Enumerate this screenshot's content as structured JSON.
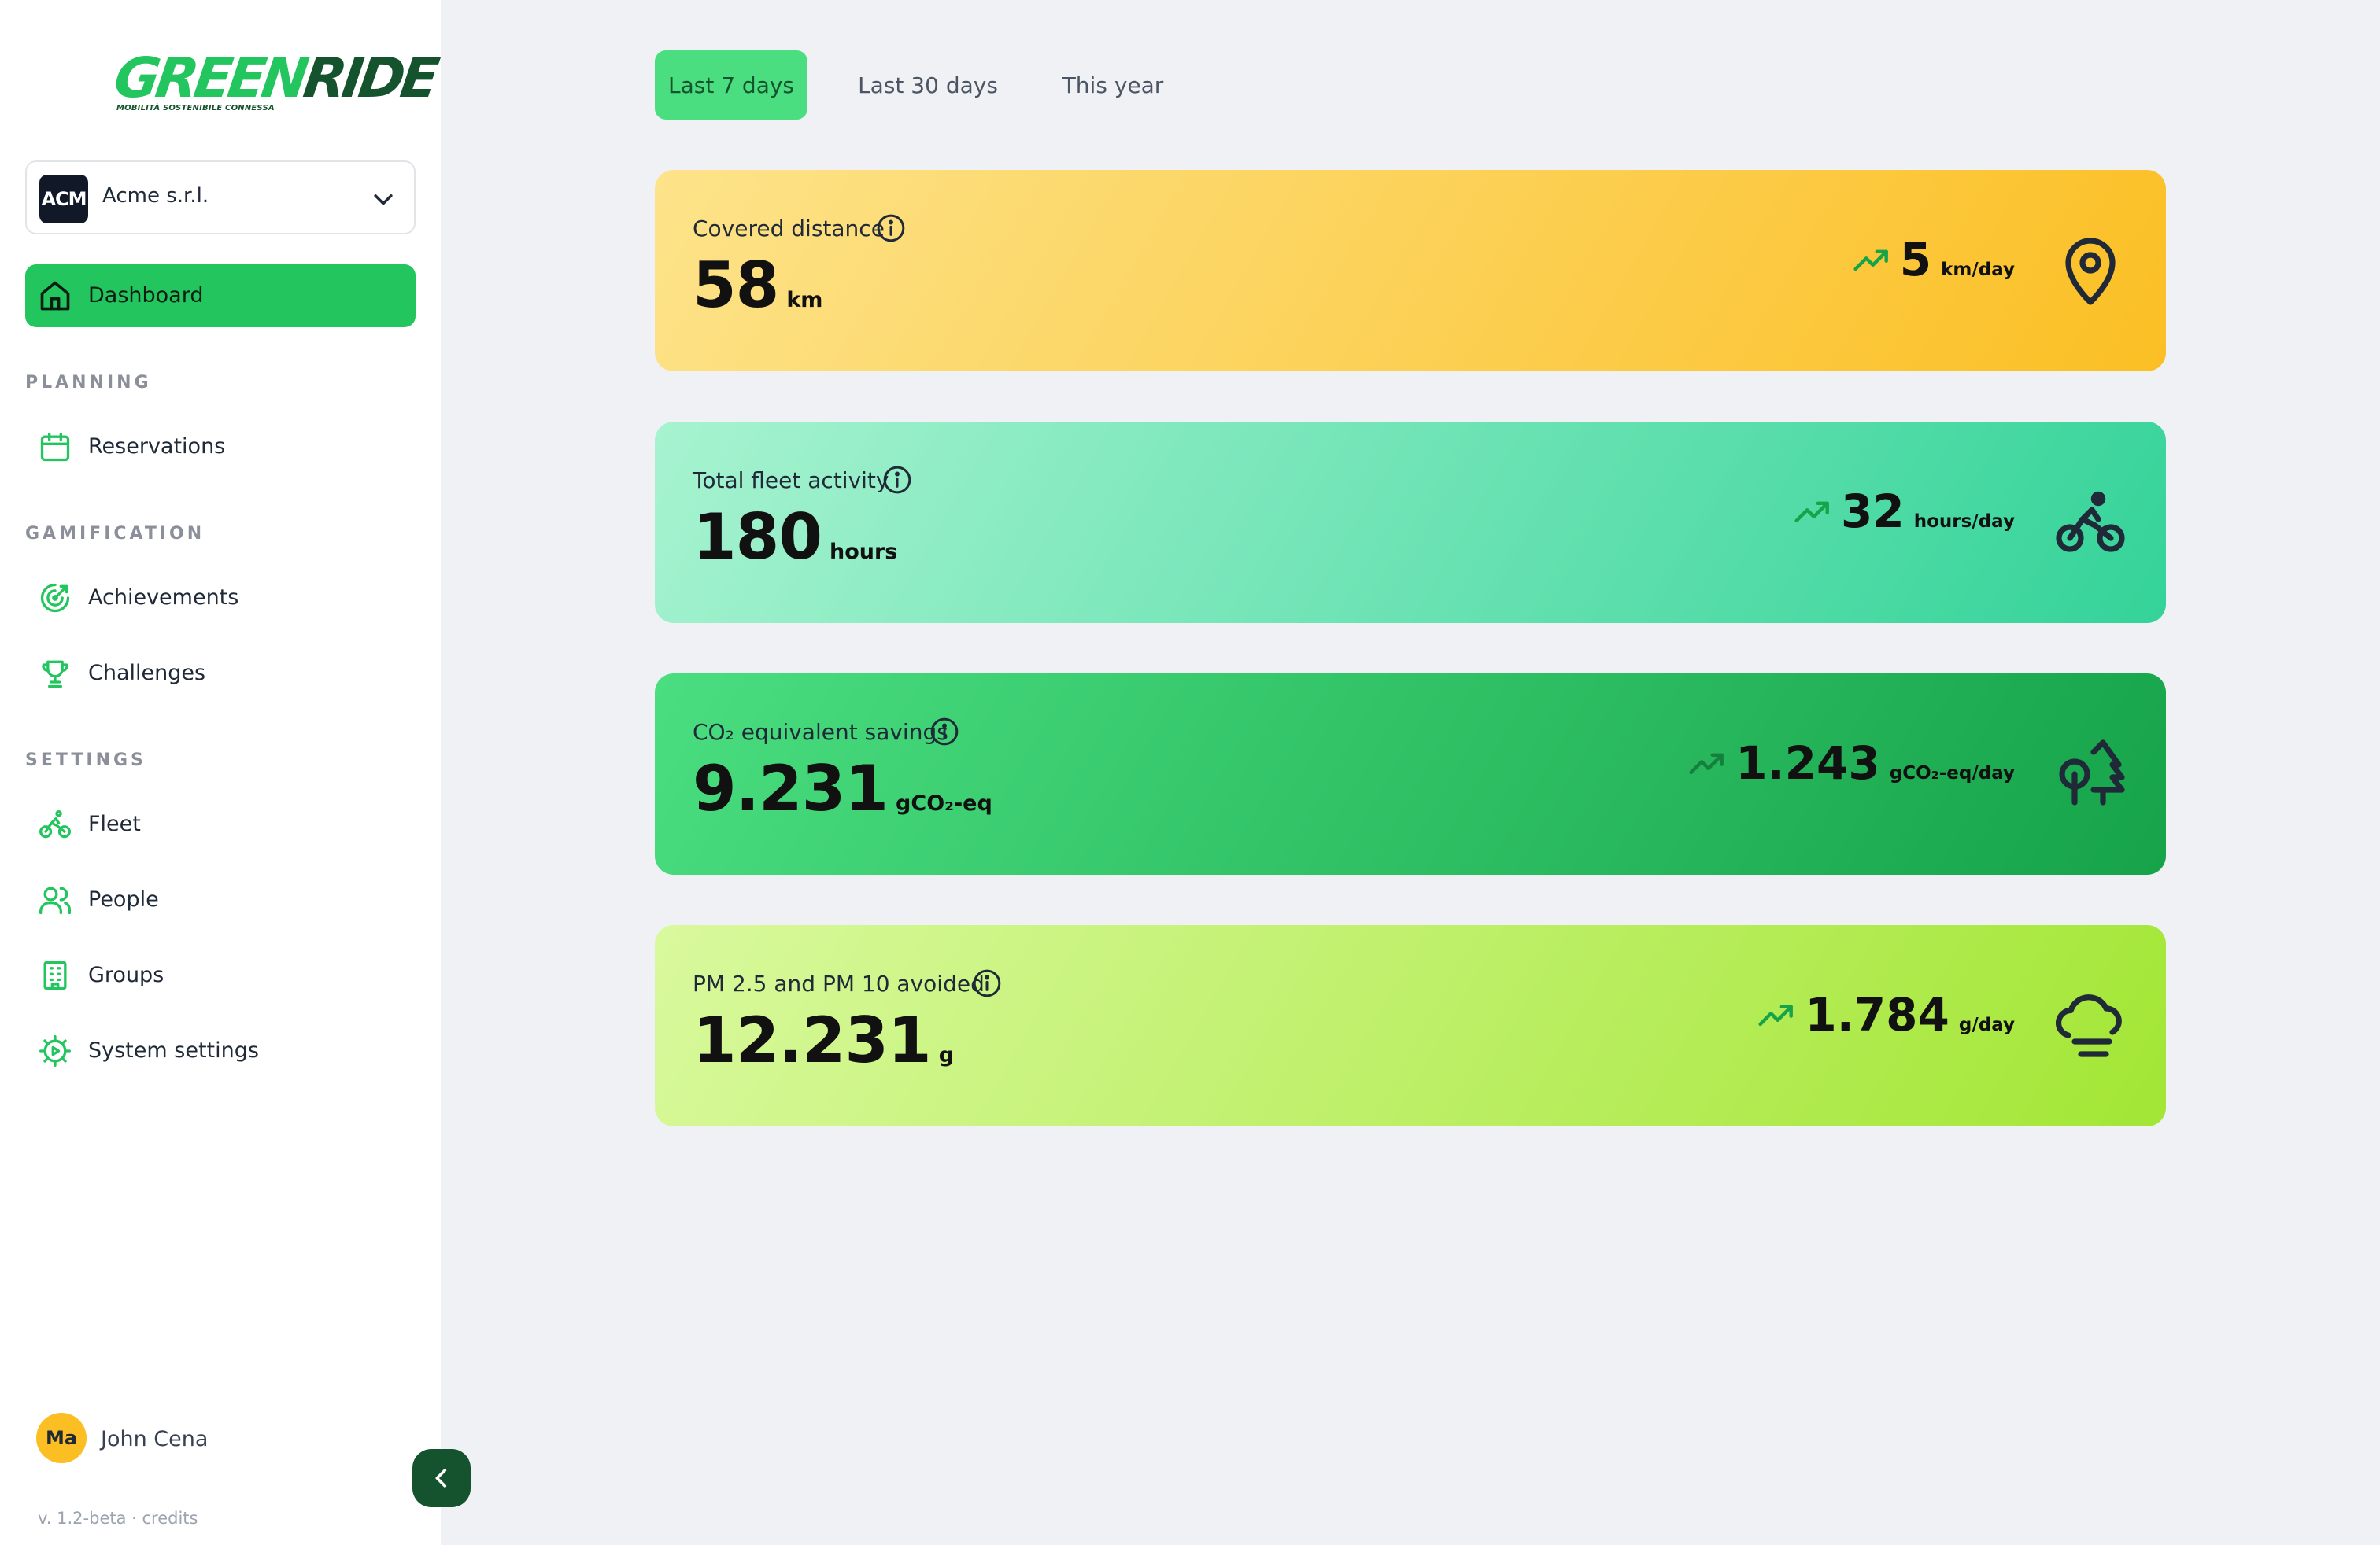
{
  "brand": {
    "part1": "GREEN",
    "part2": "RIDE",
    "tagline": "MOBILITÀ SOSTENIBILE CONNESSA",
    "green": "#22c55e",
    "dark": "#14532d"
  },
  "org": {
    "avatar": "ACM",
    "name": "Acme s.r.l."
  },
  "nav": {
    "dashboard": "Dashboard",
    "planning_title": "PLANNING",
    "reservations": "Reservations",
    "gamification_title": "GAMIFICATION",
    "achievements": "Achievements",
    "challenges": "Challenges",
    "settings_title": "SETTINGS",
    "fleet": "Fleet",
    "people": "People",
    "groups": "Groups",
    "system_settings": "System settings"
  },
  "user": {
    "initials": "Ma",
    "name": "John Cena"
  },
  "footer": {
    "version": "v. 1.2-beta · credits"
  },
  "tabs": {
    "last7": "Last 7 days",
    "last30": "Last 30 days",
    "year": "This year",
    "active": "Last 7 days"
  },
  "cards": [
    {
      "title": "Covered distance",
      "value": "58",
      "unit": "km",
      "trend_value": "5",
      "trend_unit": "km/day",
      "icon": "map-pin-icon",
      "gradient": [
        "#fde38a",
        "#fbbf24"
      ]
    },
    {
      "title": "Total fleet activity",
      "value": "180",
      "unit": "hours",
      "trend_value": "32",
      "trend_unit": "hours/day",
      "icon": "bicycle-rider-icon",
      "gradient": [
        "#a7f3d0",
        "#34d399"
      ]
    },
    {
      "title": "CO₂ equivalent savings",
      "value": "9.231",
      "unit": "gCO₂-eq",
      "trend_value": "1.243",
      "trend_unit": "gCO₂-eq/day",
      "icon": "trees-icon",
      "gradient": [
        "#4ade80",
        "#16a34a"
      ]
    },
    {
      "title": "PM 2.5 and PM 10 avoided",
      "value": "12.231",
      "unit": "g",
      "trend_value": "1.784",
      "trend_unit": "g/day",
      "icon": "cloud-fog-icon",
      "gradient": [
        "#d9f99d",
        "#a3e635"
      ]
    }
  ]
}
